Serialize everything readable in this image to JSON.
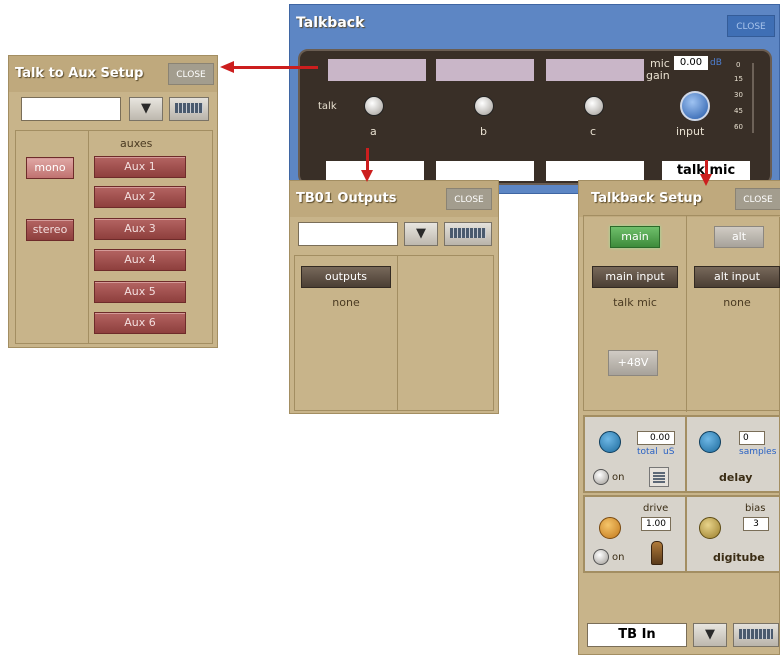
{
  "talkback": {
    "title": "Talkback",
    "close": "CLOSE",
    "talk_label": "talk",
    "channels": [
      "a",
      "b",
      "c"
    ],
    "mic_label": "mic",
    "gain_label": "gain",
    "gain_value": "0.00",
    "gain_unit": "dB",
    "input_label": "input",
    "meter_scale": [
      "0",
      "15",
      "30",
      "45",
      "60"
    ],
    "source_name": "talk mic"
  },
  "talk_to_aux": {
    "title": "Talk to Aux Setup",
    "close": "CLOSE",
    "auxes_label": "auxes",
    "mono": "mono",
    "stereo": "stereo",
    "aux_buttons": [
      "Aux 1",
      "Aux 2",
      "Aux 3",
      "Aux 4",
      "Aux 5",
      "Aux 6"
    ]
  },
  "tb01_outputs": {
    "title": "TB01 Outputs",
    "close": "CLOSE",
    "outputs_button": "outputs",
    "outputs_value": "none"
  },
  "talkback_setup": {
    "title": "Talkback Setup",
    "close": "CLOSE",
    "main": "main",
    "alt": "alt",
    "main_input_button": "main input",
    "alt_input_button": "alt input",
    "main_input_value": "talk mic",
    "alt_input_value": "none",
    "phantom": "+48V",
    "delay_total": "0.00",
    "delay_total_label": "total",
    "delay_unit": "uS",
    "delay_samples": "0",
    "samples_label": "samples",
    "on_label": "on",
    "delay_label": "delay",
    "drive_label": "drive",
    "drive_value": "1.00",
    "bias_label": "bias",
    "bias_value": "3",
    "digitube_label": "digitube",
    "bottom_selector": "TB In"
  },
  "colors": {
    "accent_blue": "#5d86c4",
    "panel_tan": "#c8b48a",
    "arrow_red": "#cc1e1e",
    "button_red": "#a04e4c",
    "button_green": "#4ea24a"
  }
}
